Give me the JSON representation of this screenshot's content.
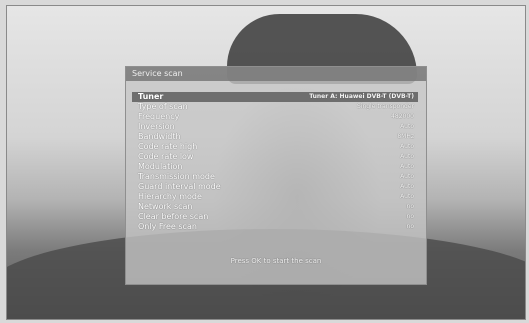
{
  "dialog": {
    "title": "Service scan",
    "footer": "Press OK to start the scan"
  },
  "rows": [
    {
      "label": "Tuner",
      "value": "Tuner A: Huawei DVB-T (DVB-T)"
    },
    {
      "label": "Type of scan",
      "value": "Single transponder"
    },
    {
      "label": "Frequency",
      "value": "482000"
    },
    {
      "label": "Inversion",
      "value": "Auto"
    },
    {
      "label": "Bandwidth",
      "value": "8MHz"
    },
    {
      "label": "Code rate high",
      "value": "Auto"
    },
    {
      "label": "Code rate low",
      "value": "Auto"
    },
    {
      "label": "Modulation",
      "value": "Auto"
    },
    {
      "label": "Transmission mode",
      "value": "Auto"
    },
    {
      "label": "Guard interval mode",
      "value": "Auto"
    },
    {
      "label": "Hierarchy mode",
      "value": "Auto"
    },
    {
      "label": "Network scan",
      "value": "no"
    },
    {
      "label": "Clear before scan",
      "value": "no"
    },
    {
      "label": "Only Free scan",
      "value": "no"
    }
  ]
}
